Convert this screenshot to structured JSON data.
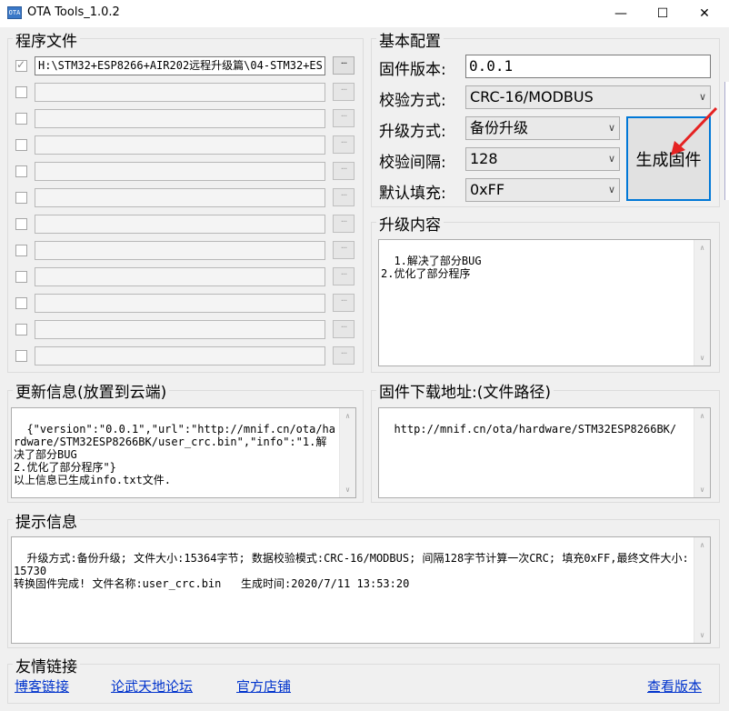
{
  "window": {
    "title": "OTA Tools_1.0.2",
    "app_icon": "OTA",
    "minimize_icon": "—",
    "maximize_icon": "☐",
    "close_icon": "✕"
  },
  "program_files": {
    "title": "程序文件",
    "browse_label": "···",
    "rows": [
      {
        "checked": true,
        "path": "H:\\STM32+ESP8266+AIR202远程升级篇\\04-STM32+ES"
      },
      {
        "checked": false,
        "path": ""
      },
      {
        "checked": false,
        "path": ""
      },
      {
        "checked": false,
        "path": ""
      },
      {
        "checked": false,
        "path": ""
      },
      {
        "checked": false,
        "path": ""
      },
      {
        "checked": false,
        "path": ""
      },
      {
        "checked": false,
        "path": ""
      },
      {
        "checked": false,
        "path": ""
      },
      {
        "checked": false,
        "path": ""
      },
      {
        "checked": false,
        "path": ""
      },
      {
        "checked": false,
        "path": ""
      }
    ]
  },
  "basic_config": {
    "title": "基本配置",
    "firmware_version_label": "固件版本:",
    "firmware_version_value": "0.0.1",
    "checksum_mode_label": "校验方式:",
    "checksum_mode_value": "CRC-16/MODBUS",
    "upgrade_mode_label": "升级方式:",
    "upgrade_mode_value": "备份升级",
    "check_interval_label": "校验间隔:",
    "check_interval_value": "128",
    "default_fill_label": "默认填充:",
    "default_fill_value": "0xFF",
    "generate_button": "生成固件"
  },
  "upgrade_content": {
    "title": "升级内容",
    "text": "1.解决了部分BUG\n2.优化了部分程序"
  },
  "update_info": {
    "title": "更新信息(放置到云端)",
    "text": "{\"version\":\"0.0.1\",\"url\":\"http://mnif.cn/ota/hardware/STM32ESP8266BK/user_crc.bin\",\"info\":\"1.解决了部分BUG\n2.优化了部分程序\"}\n以上信息已生成info.txt文件."
  },
  "download_url": {
    "title": "固件下载地址:(文件路径)",
    "text": "http://mnif.cn/ota/hardware/STM32ESP8266BK/"
  },
  "tips": {
    "title": "提示信息",
    "text": "升级方式:备份升级; 文件大小:15364字节; 数据校验模式:CRC-16/MODBUS; 间隔128字节计算一次CRC; 填充0xFF,最终文件大小:15730\n转换固件完成! 文件名称:user_crc.bin   生成时间:2020/7/11 13:53:20"
  },
  "links": {
    "title": "友情链接",
    "blog": "博客链接",
    "forum": "论武天地论坛",
    "shop": "官方店铺",
    "version": "查看版本"
  }
}
